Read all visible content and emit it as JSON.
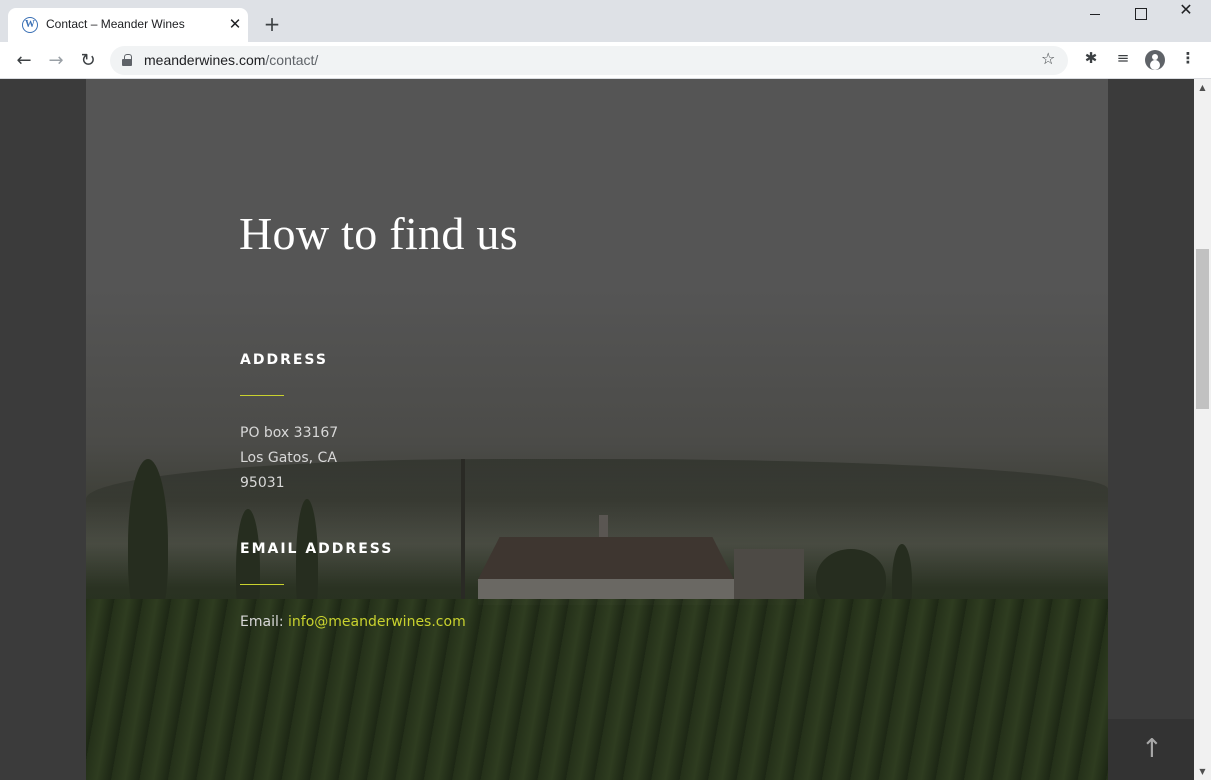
{
  "browser": {
    "tab_title": "Contact – Meander Wines",
    "tab_favicon": "W",
    "tab_close": "✕",
    "new_tab": "+",
    "url_domain": "meanderwines.com",
    "url_path": "/contact/",
    "window_close": "✕"
  },
  "page": {
    "heading": "How to find us",
    "address": {
      "label": "ADDRESS",
      "lines": [
        "PO box 33167",
        "Los Gatos, CA",
        "95031"
      ]
    },
    "email": {
      "label": "EMAIL ADDRESS",
      "prefix": "Email:",
      "address": "info@meanderwines.com"
    },
    "scroll_top_arrow": "↑"
  },
  "colors": {
    "accent": "#c9d22e",
    "overlay": "#555555"
  }
}
